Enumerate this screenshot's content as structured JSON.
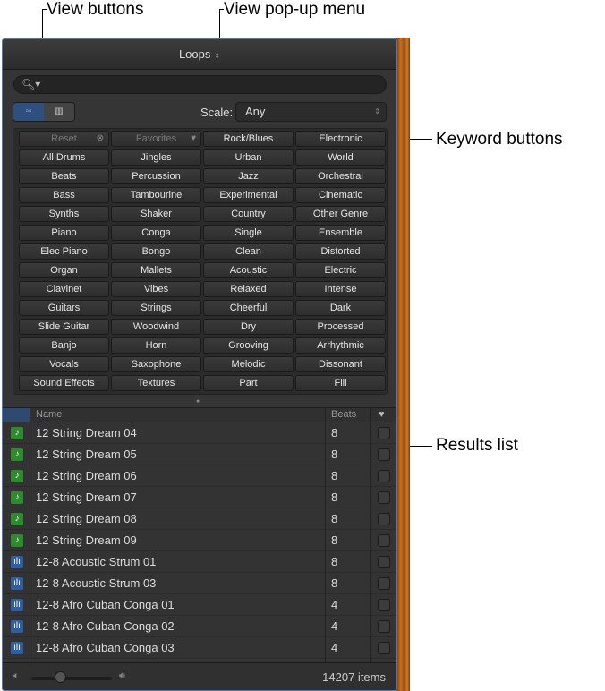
{
  "callouts": {
    "view_buttons": "View buttons",
    "view_popup": "View pop-up menu",
    "keyword_buttons": "Keyword buttons",
    "results_list": "Results list"
  },
  "header": {
    "title": "Loops",
    "updown_icon": "⇕"
  },
  "search": {
    "icon": "🔍︎▾",
    "value": ""
  },
  "view_buttons": [
    {
      "name": "button-view",
      "icon": "▫▫"
    },
    {
      "name": "column-view",
      "icon": "▥"
    }
  ],
  "scale": {
    "label": "Scale:",
    "value": "Any"
  },
  "keywords": [
    "Reset",
    "Favorites",
    "Rock/Blues",
    "Electronic",
    "All Drums",
    "Jingles",
    "Urban",
    "World",
    "Beats",
    "Percussion",
    "Jazz",
    "Orchestral",
    "Bass",
    "Tambourine",
    "Experimental",
    "Cinematic",
    "Synths",
    "Shaker",
    "Country",
    "Other Genre",
    "Piano",
    "Conga",
    "Single",
    "Ensemble",
    "Elec Piano",
    "Bongo",
    "Clean",
    "Distorted",
    "Organ",
    "Mallets",
    "Acoustic",
    "Electric",
    "Clavinet",
    "Vibes",
    "Relaxed",
    "Intense",
    "Guitars",
    "Strings",
    "Cheerful",
    "Dark",
    "Slide Guitar",
    "Woodwind",
    "Dry",
    "Processed",
    "Banjo",
    "Horn",
    "Grooving",
    "Arrhythmic",
    "Vocals",
    "Saxophone",
    "Melodic",
    "Dissonant",
    "Sound Effects",
    "Textures",
    "Part",
    "Fill"
  ],
  "table": {
    "headers": {
      "name": "Name",
      "beats": "Beats",
      "fav": "♥"
    },
    "rows": [
      {
        "type": "midi",
        "name": "12 String Dream 04",
        "beats": "8"
      },
      {
        "type": "midi",
        "name": "12 String Dream 05",
        "beats": "8"
      },
      {
        "type": "midi",
        "name": "12 String Dream 06",
        "beats": "8"
      },
      {
        "type": "midi",
        "name": "12 String Dream 07",
        "beats": "8"
      },
      {
        "type": "midi",
        "name": "12 String Dream 08",
        "beats": "8"
      },
      {
        "type": "midi",
        "name": "12 String Dream 09",
        "beats": "8"
      },
      {
        "type": "audio",
        "name": "12-8 Acoustic Strum 01",
        "beats": "8"
      },
      {
        "type": "audio",
        "name": "12-8 Acoustic Strum 03",
        "beats": "8"
      },
      {
        "type": "audio",
        "name": "12-8 Afro Cuban Conga 01",
        "beats": "4"
      },
      {
        "type": "audio",
        "name": "12-8 Afro Cuban Conga 02",
        "beats": "4"
      },
      {
        "type": "audio",
        "name": "12-8 Afro Cuban Conga 03",
        "beats": "4"
      }
    ]
  },
  "footer": {
    "volume": 0.35,
    "count": "14207 items"
  }
}
